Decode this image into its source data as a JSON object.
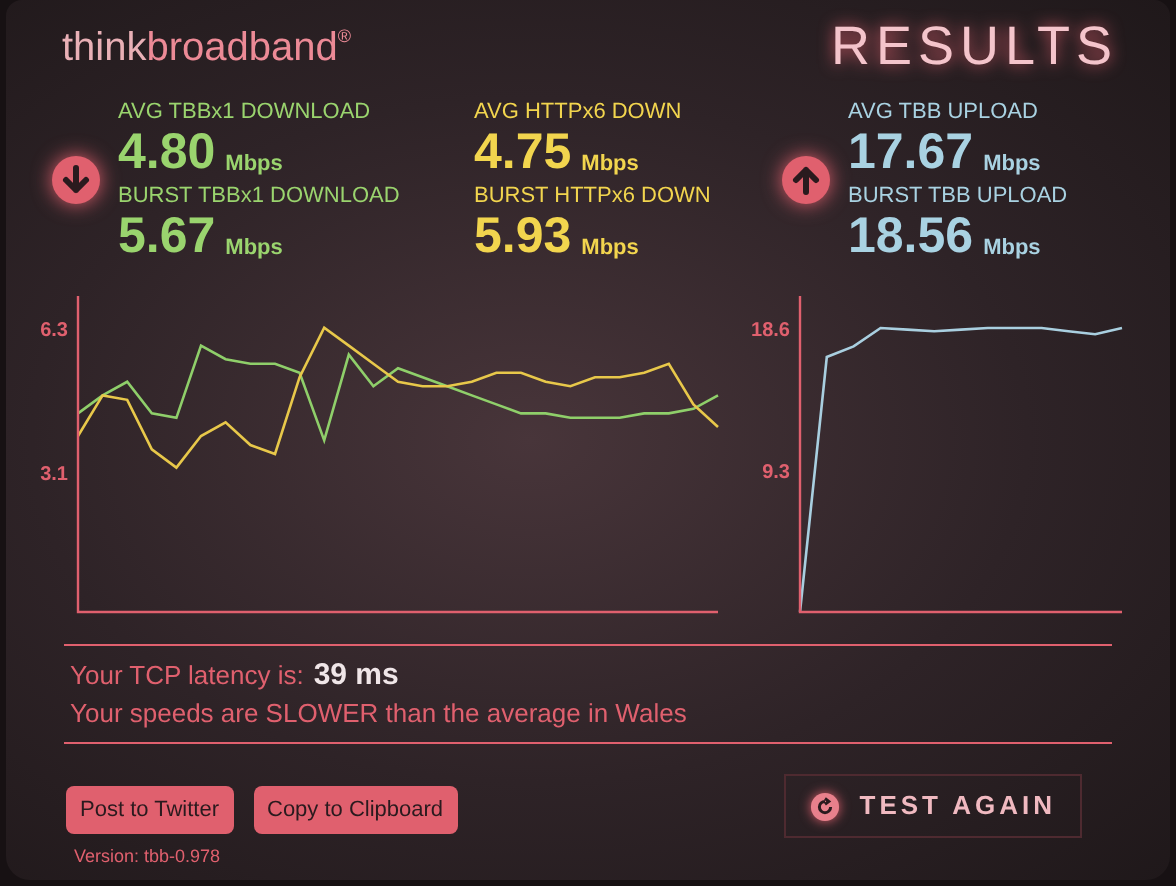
{
  "logo": {
    "think": "think",
    "broadband": "broadband",
    "mark": "®"
  },
  "title": "RESULTS",
  "metric_columns": [
    {
      "kind": "download",
      "color": "#9ad46e",
      "items": [
        {
          "label": "AVG TBBx1 DOWNLOAD",
          "value": "4.80",
          "unit": "Mbps"
        },
        {
          "label": "BURST TBBx1 DOWNLOAD",
          "value": "5.67",
          "unit": "Mbps"
        }
      ]
    },
    {
      "kind": "plain",
      "color": "#f2d54e",
      "items": [
        {
          "label": "AVG HTTPx6 DOWN",
          "value": "4.75",
          "unit": "Mbps"
        },
        {
          "label": "BURST HTTPx6 DOWN",
          "value": "5.93",
          "unit": "Mbps"
        }
      ]
    },
    {
      "kind": "upload",
      "color": "#a9d2e2",
      "items": [
        {
          "label": "AVG TBB UPLOAD",
          "value": "17.67",
          "unit": "Mbps"
        },
        {
          "label": "BURST TBB UPLOAD",
          "value": "18.56",
          "unit": "Mbps"
        }
      ]
    }
  ],
  "charts": [
    {
      "chart_data": {
        "type": "line",
        "ylim": [
          0,
          7
        ],
        "yticks": [
          3.1,
          6.3
        ],
        "series": [
          {
            "color": "#8fcf6a",
            "values": [
              4.4,
              4.8,
              5.1,
              4.4,
              4.3,
              5.9,
              5.6,
              5.5,
              5.5,
              5.3,
              3.8,
              5.7,
              5.0,
              5.4,
              5.2,
              5.0,
              4.8,
              4.6,
              4.4,
              4.4,
              4.3,
              4.3,
              4.3,
              4.4,
              4.4,
              4.5,
              4.8
            ]
          },
          {
            "color": "#e8c84a",
            "values": [
              3.9,
              4.8,
              4.7,
              3.6,
              3.2,
              3.9,
              4.2,
              3.7,
              3.5,
              5.2,
              6.3,
              5.9,
              5.5,
              5.1,
              5.0,
              5.0,
              5.1,
              5.3,
              5.3,
              5.1,
              5.0,
              5.2,
              5.2,
              5.3,
              5.5,
              4.6,
              4.1
            ]
          }
        ]
      }
    },
    {
      "chart_data": {
        "type": "line",
        "ylim": [
          0,
          20.7
        ],
        "yticks": [
          9.3,
          18.6
        ],
        "series": [
          {
            "color": "#a9cfe0",
            "values": [
              0,
              16.7,
              17.4,
              18.6,
              18.5,
              18.4,
              18.5,
              18.6,
              18.6,
              18.6,
              18.4,
              18.2,
              18.6
            ]
          }
        ]
      }
    }
  ],
  "latency": {
    "label": "Your TCP latency is:",
    "value": "39 ms"
  },
  "comparison": "Your speeds are SLOWER than the average in Wales",
  "buttons": [
    "Post to Twitter",
    "Copy to Clipboard"
  ],
  "test_again": "TEST AGAIN",
  "version": "Version: tbb-0.978"
}
